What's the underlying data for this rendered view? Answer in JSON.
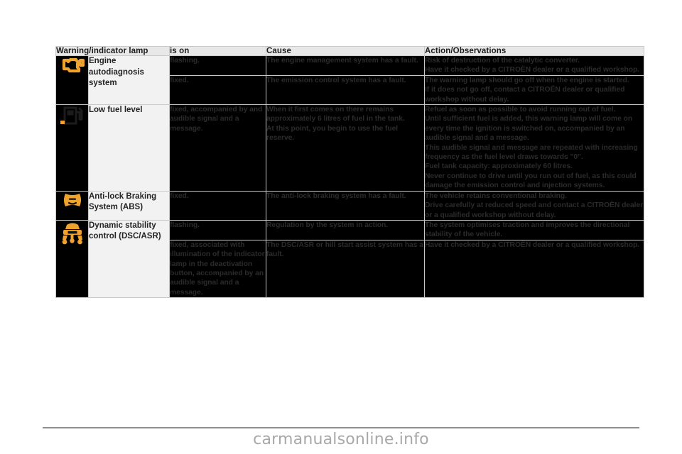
{
  "document": {
    "watermark": "carmanualsonline.info"
  },
  "table": {
    "headers": {
      "lamp": "Warning/indicator lamp",
      "is_on": "is on",
      "cause": "Cause",
      "action": "Action/Observations"
    },
    "groups": [
      {
        "icon": "engine-check-icon",
        "icon_color": "#F0A22E",
        "label": "Engine autodiagnosis system",
        "rows": [
          {
            "is_on": "flashing.",
            "cause": "The engine management system has a fault.",
            "action": "Risk of destruction of the catalytic converter.\nHave it checked by a CITROËN dealer or a qualified workshop."
          },
          {
            "is_on": "fixed.",
            "cause": "The emission control system has a fault.",
            "action": "The warning lamp should go off when the engine is started.\nIf it does not go off, contact a CITROËN dealer or qualified workshop without delay."
          }
        ]
      },
      {
        "icon": "fuel-pump-icon",
        "icon_color": "#1A1A1A",
        "icon_accent_color": "#F0A22E",
        "label": "Low fuel level",
        "rows": [
          {
            "is_on": "fixed, accompanied by and audible signal and a message.",
            "cause": "When it first comes on there remains approximately 6 litres of fuel in the tank.\nAt this point, you begin to use the fuel reserve.",
            "action": "Refuel as soon as possible to avoid running out of fuel.\nUntil sufficient fuel is added, this warning lamp will come on every time the ignition is switched on, accompanied by an audible signal and a message.\nThis audible signal and message are repeated with increasing frequency as the fuel level draws towards \"0\".\nFuel tank capacity: approximately 60 litres.\nNever continue to drive until you run out of fuel, as this could damage the emission control and injection systems."
          }
        ]
      },
      {
        "icon": "abs-icon",
        "icon_color": "#F0A22E",
        "label": "Anti-lock Braking System (ABS)",
        "rows": [
          {
            "is_on": "fixed.",
            "cause": "The anti-lock braking system has a fault.",
            "action": "The vehicle retains conventional braking.\nDrive carefully at reduced speed and contact a CITROËN dealer or a qualified workshop without delay."
          }
        ]
      },
      {
        "icon": "dsc-asr-icon",
        "icon_color": "#F0A22E",
        "label": "Dynamic stability control (DSC/ASR)",
        "rows": [
          {
            "is_on": "flashing.",
            "cause": "Regulation by the system in action.",
            "action": "The system optimises traction and improves the directional stability of the vehicle."
          },
          {
            "is_on": "fixed, associated with illumination of the indicator lamp in the deactivation button, accompanied by an audible signal and a message.",
            "cause": "The DSC/ASR or hill start assist system has a fault.",
            "action": "Have it checked by a CITROËN dealer or a qualified workshop."
          }
        ]
      }
    ]
  }
}
